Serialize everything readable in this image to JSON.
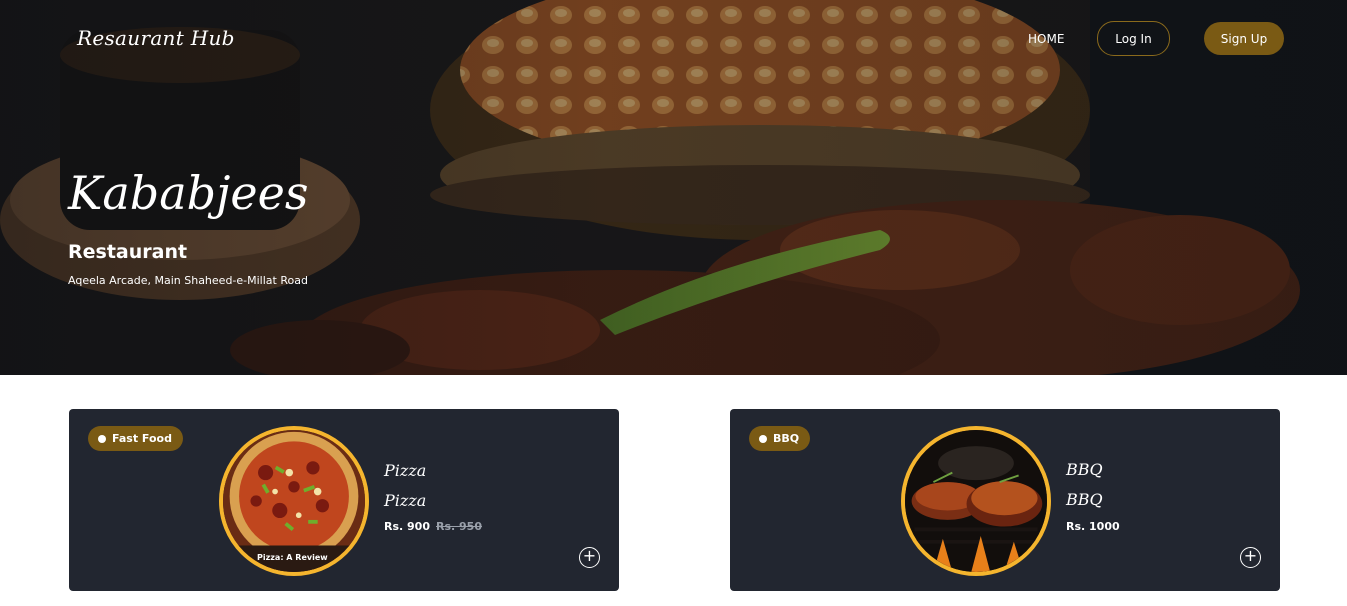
{
  "header": {
    "brand": "Resaurant Hub",
    "nav_home": "HOME",
    "login_label": "Log In",
    "signup_label": "Sign Up"
  },
  "hero": {
    "title": "Kababjees",
    "subtitle": "Restaurant",
    "address": "Aqeela Arcade, Main Shaheed-e-Millat Road"
  },
  "cards": [
    {
      "category": "Fast Food",
      "name": "Pizza",
      "title": "Pizza",
      "price": "Rs. 900",
      "old_price": "Rs. 950",
      "image_caption": "Pizza: A Review"
    },
    {
      "category": "BBQ",
      "name": "BBQ",
      "title": "BBQ",
      "price": "Rs. 1000"
    }
  ],
  "colors": {
    "accent": "#7a5a14",
    "card_bg": "#222630",
    "ring": "#f5b52e"
  }
}
